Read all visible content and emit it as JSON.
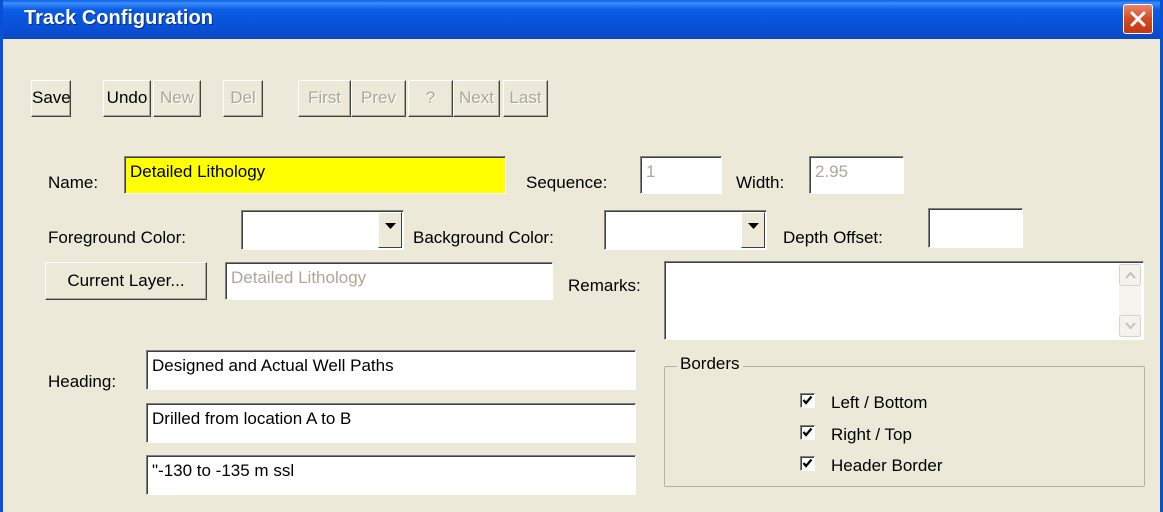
{
  "window": {
    "title": "Track Configuration"
  },
  "toolbar": {
    "save": "Save",
    "undo": "Undo",
    "new": "New",
    "del": "Del",
    "first": "First",
    "prev": "Prev",
    "help": "?",
    "next": "Next",
    "last": "Last"
  },
  "form": {
    "name_label": "Name:",
    "name_value": "Detailed Lithology",
    "sequence_label": "Sequence:",
    "sequence_value": "1",
    "width_label": "Width:",
    "width_value": "2.95",
    "fg_label": "Foreground Color:",
    "fg_value": "",
    "bg_label": "Background Color:",
    "bg_value": "",
    "depth_label": "Depth Offset:",
    "depth_value": "",
    "current_layer_button": "Current Layer...",
    "current_layer_value": "Detailed Lithology",
    "remarks_label": "Remarks:",
    "remarks_value": "",
    "heading_label": "Heading:",
    "heading_lines": [
      "Designed and Actual Well Paths",
      "Drilled from location A to B",
      "\"-130 to -135 m ssl"
    ]
  },
  "borders": {
    "title": "Borders",
    "options": [
      {
        "label": "Left / Bottom",
        "checked": true
      },
      {
        "label": "Right / Top",
        "checked": true
      },
      {
        "label": "Header Border",
        "checked": true
      }
    ]
  },
  "icons": {
    "close": "close-icon",
    "dropdown": "chevron-down-icon",
    "scroll_up": "scroll-up-arrow-icon",
    "scroll_down": "scroll-down-arrow-icon",
    "check": "check-icon"
  },
  "colors": {
    "titlebar": "#0b5ce6",
    "dialog_bg": "#ece9d8",
    "name_highlight": "#ffff00",
    "close_button": "#d44a22"
  }
}
